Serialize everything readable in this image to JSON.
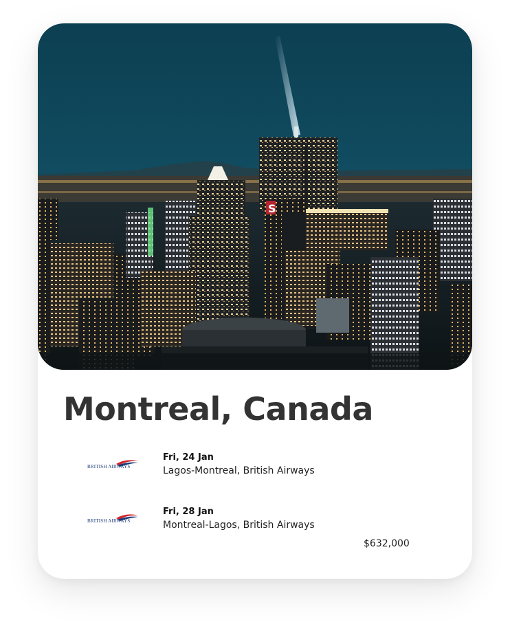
{
  "card": {
    "image_icon": "city-skyline-night-photo",
    "title": "Montreal, Canada"
  },
  "flights": [
    {
      "airline_logo_text": "BRITISH AIRWAYS",
      "date": "Fri, 24 Jan",
      "route": "Lagos-Montreal, British Airways"
    },
    {
      "airline_logo_text": "BRITISH AIRWAYS",
      "date": "Fri, 28 Jan",
      "route": "Montreal-Lagos, British Airways"
    }
  ],
  "price": "$632,000",
  "colors": {
    "title": "#333333",
    "sky": "#12485a",
    "airline_blue": "#1d3c78",
    "airline_red": "#d3242c"
  }
}
